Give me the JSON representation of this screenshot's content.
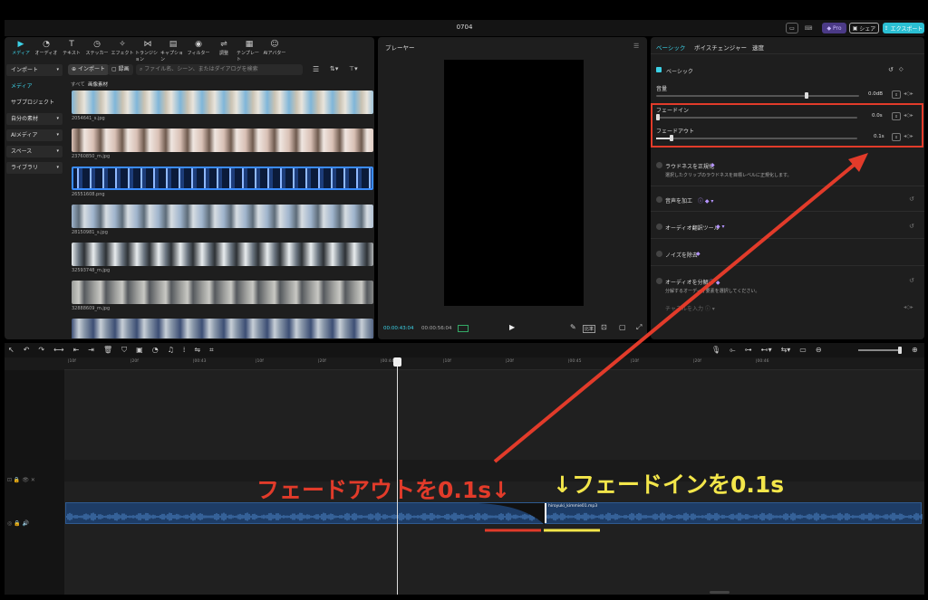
{
  "window": {
    "title": "0704",
    "pro_label": "Pro",
    "share_label": "シェア",
    "export_label": "エクスポート"
  },
  "left": {
    "tools": [
      {
        "label": "メディア",
        "icon": "media-icon",
        "active": true
      },
      {
        "label": "オーディオ",
        "icon": "audio-icon"
      },
      {
        "label": "テキスト",
        "icon": "text-icon"
      },
      {
        "label": "ステッカー",
        "icon": "sticker-icon"
      },
      {
        "label": "エフェクト",
        "icon": "effect-icon"
      },
      {
        "label": "トランジション",
        "icon": "transition-icon"
      },
      {
        "label": "キャプション",
        "icon": "caption-icon"
      },
      {
        "label": "フィルター",
        "icon": "filter-icon"
      },
      {
        "label": "調整",
        "icon": "adjust-icon"
      },
      {
        "label": "テンプレート",
        "icon": "template-icon"
      },
      {
        "label": "AIアバター",
        "icon": "ai-avatar-icon"
      }
    ],
    "nav": [
      {
        "label": "インポート",
        "box": true,
        "chev": true
      },
      {
        "label": "メディア",
        "sel": true
      },
      {
        "label": "サブプロジェクト"
      },
      {
        "label": "自分の素材",
        "box": true,
        "chev": true
      },
      {
        "label": "AIメディア",
        "box": true,
        "chev": true
      },
      {
        "label": "スペース",
        "box": true,
        "chev": true
      },
      {
        "label": "ライブラリ",
        "box": true,
        "chev": true
      }
    ],
    "import_button": "インポート",
    "record_button": "録画",
    "search_placeholder": "ファイル名、シーン、またはダイアログを検索",
    "filter_all": "すべて",
    "filter_images": "画像素材",
    "files": [
      "2054641_s.jpg",
      "23760850_m.jpg",
      "26551608.png",
      "28150981_s.jpg",
      "32593748_m.jpg",
      "32888609_m.jpg",
      ""
    ]
  },
  "player": {
    "title": "プレーヤー",
    "time_current": "00:00:43:04",
    "time_total": "00:00:56:04",
    "ratio_label": "比率"
  },
  "right": {
    "tabs": [
      "ベーシック",
      "ボイスチェンジャー",
      "速度"
    ],
    "section_basic": "ベーシック",
    "volume_label": "音量",
    "volume_value": "0.0dB",
    "fade_in_label": "フェードイン",
    "fade_in_value": "0.0s",
    "fade_out_label": "フェードアウト",
    "fade_out_value": "0.1s",
    "loudness_title": "ラウドネスを正規化",
    "loudness_sub": "選択したクリップのラウドネスを目標レベルに正規化します。",
    "enhance_title": "音声を加工",
    "translate_title": "オーディオ翻訳ツール",
    "noise_title": "ノイズを除去",
    "separate_title": "オーディオを分解",
    "separate_sub": "分解するオーディオ要素を選択してください。",
    "channel_title": "チャネルを入力"
  },
  "timeline": {
    "ruler": [
      "|10f",
      "|20f",
      "|00:43",
      "|10f",
      "|20f",
      "|00:44",
      "|10f",
      "|20f",
      "|00:45",
      "|10f",
      "|20f",
      "|00:46"
    ],
    "clip_name": "hiroyuki_kimmie01.mp3"
  },
  "annotations": {
    "fade_out_text": "フェードアウトを0.1s↓",
    "fade_in_text": "↓フェードインを0.1s",
    "red_color": "#e23b2a",
    "yellow_color": "#f3e64a"
  }
}
